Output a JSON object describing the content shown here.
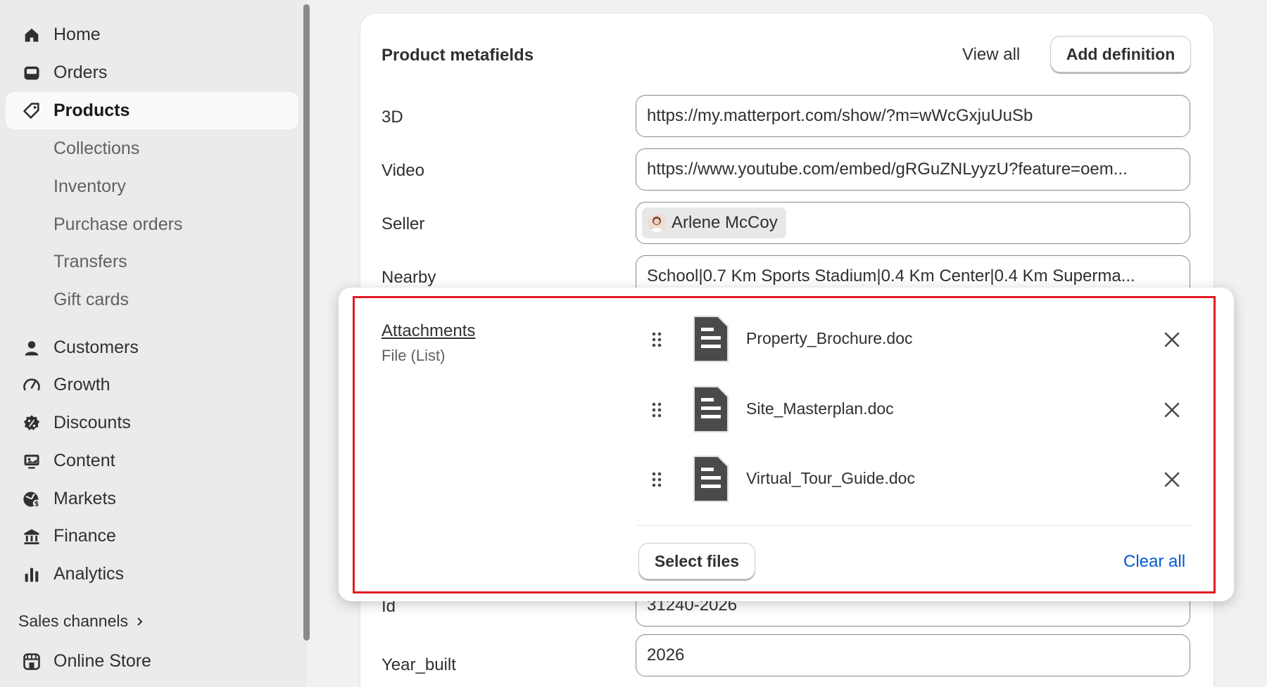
{
  "sidebar": {
    "items": [
      {
        "label": "Home",
        "icon": "home-icon"
      },
      {
        "label": "Orders",
        "icon": "orders-icon"
      },
      {
        "label": "Products",
        "icon": "tag-icon"
      },
      {
        "label": "Customers",
        "icon": "person-icon"
      },
      {
        "label": "Growth",
        "icon": "gauge-icon"
      },
      {
        "label": "Discounts",
        "icon": "discount-icon"
      },
      {
        "label": "Content",
        "icon": "content-icon"
      },
      {
        "label": "Markets",
        "icon": "globe-icon"
      },
      {
        "label": "Finance",
        "icon": "bank-icon"
      },
      {
        "label": "Analytics",
        "icon": "bar-chart-icon"
      }
    ],
    "product_subitems": [
      "Collections",
      "Inventory",
      "Purchase orders",
      "Transfers",
      "Gift cards"
    ],
    "sales_channels_label": "Sales channels",
    "online_store_label": "Online Store",
    "active_item": "Products"
  },
  "card": {
    "title": "Product metafields",
    "view_all_label": "View all",
    "add_definition_label": "Add definition",
    "fields": {
      "3d": {
        "label": "3D",
        "value": "https://my.matterport.com/show/?m=wWcGxjuUuSb"
      },
      "video": {
        "label": "Video",
        "value": "https://www.youtube.com/embed/gRGuZNLyyzU?feature=oem..."
      },
      "seller": {
        "label": "Seller",
        "value": "Arlene McCoy"
      },
      "nearby": {
        "label": "Nearby",
        "value": "School|0.7 Km Sports Stadium|0.4 Km Center|0.4 Km Superma..."
      },
      "id": {
        "label": "Id",
        "value": "31240-2026"
      },
      "year_built": {
        "label": "Year_built",
        "value": "2026"
      }
    }
  },
  "attachments": {
    "title": "Attachments",
    "type": "File (List)",
    "files": [
      "Property_Brochure.doc",
      "Site_Masterplan.doc",
      "Virtual_Tour_Guide.doc"
    ],
    "select_files_label": "Select files",
    "clear_all_label": "Clear all"
  },
  "colors": {
    "accent_link": "#005bd3",
    "highlight_border": "#e01b24",
    "sidebar_bg": "#ebebeb"
  }
}
